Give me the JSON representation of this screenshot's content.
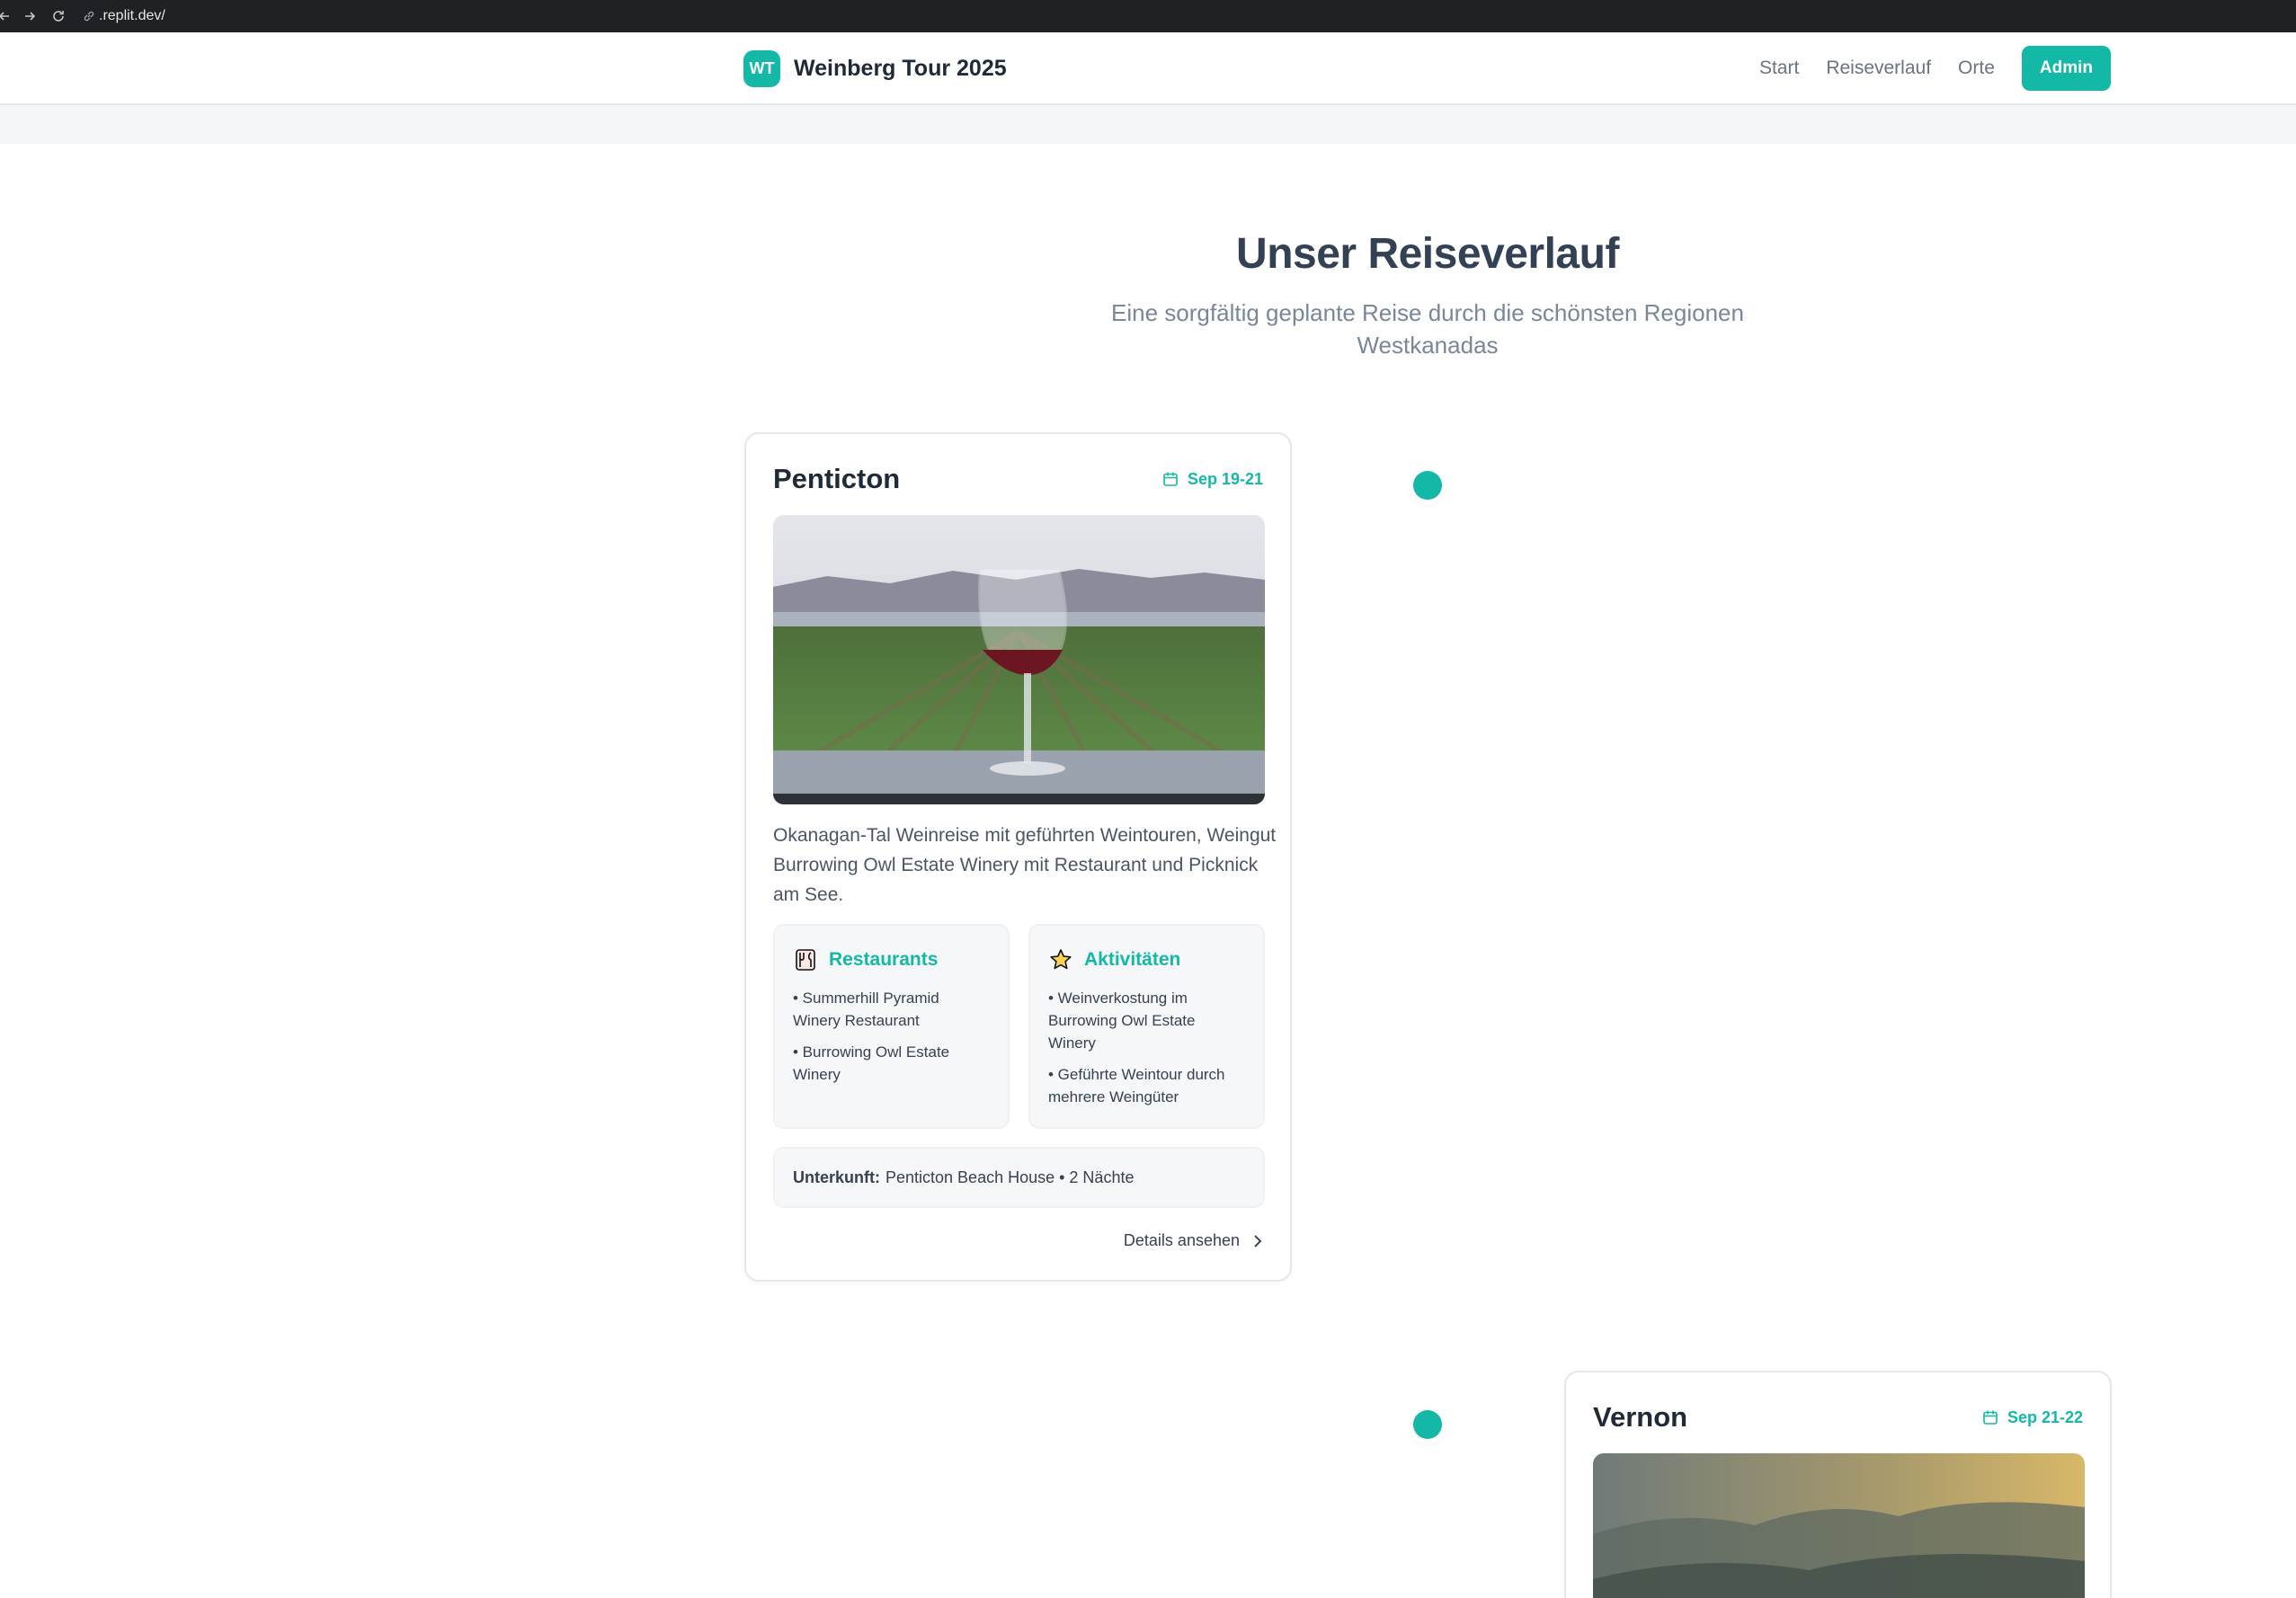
{
  "browser": {
    "url": ".replit.dev/"
  },
  "header": {
    "logo": "WT",
    "title": "Weinberg Tour 2025",
    "nav": [
      "Start",
      "Reiseverlauf",
      "Orte"
    ],
    "admin_label": "Admin"
  },
  "hero": {
    "title": "Unser Reiseverlauf",
    "subtitle": "Eine sorgfältig geplante Reise durch die schönsten Regionen Westkanadas"
  },
  "colors": {
    "accent": "#14b8a6",
    "text": "#1f2937",
    "muted": "#7a8699"
  },
  "stops": [
    {
      "title": "Penticton",
      "date": "Sep 19-21",
      "description": "Okanagan-Tal Weinreise mit geführten Weintouren, Weingut Burrowing Owl Estate Winery mit Restaurant und Picknick am See.",
      "restaurants_title": "Restaurants",
      "restaurants": [
        "• Summerhill Pyramid Winery Restaurant",
        "• Burrowing Owl Estate Winery"
      ],
      "activities_title": "Aktivitäten",
      "activities": [
        "• Weinverkostung im Burrowing Owl Estate Winery",
        "• Geführte Weintour durch mehrere Weingüter"
      ],
      "stay_label": "Unterkunft:",
      "stay_value": "Penticton Beach House • 2 Nächte",
      "details_label": "Details ansehen"
    },
    {
      "title": "Vernon",
      "date": "Sep 21-22"
    }
  ],
  "icons": {
    "calendar": "calendar-icon",
    "restaurants": "cutlery-icon",
    "activities": "star-icon",
    "details": "chevron-right-icon"
  }
}
